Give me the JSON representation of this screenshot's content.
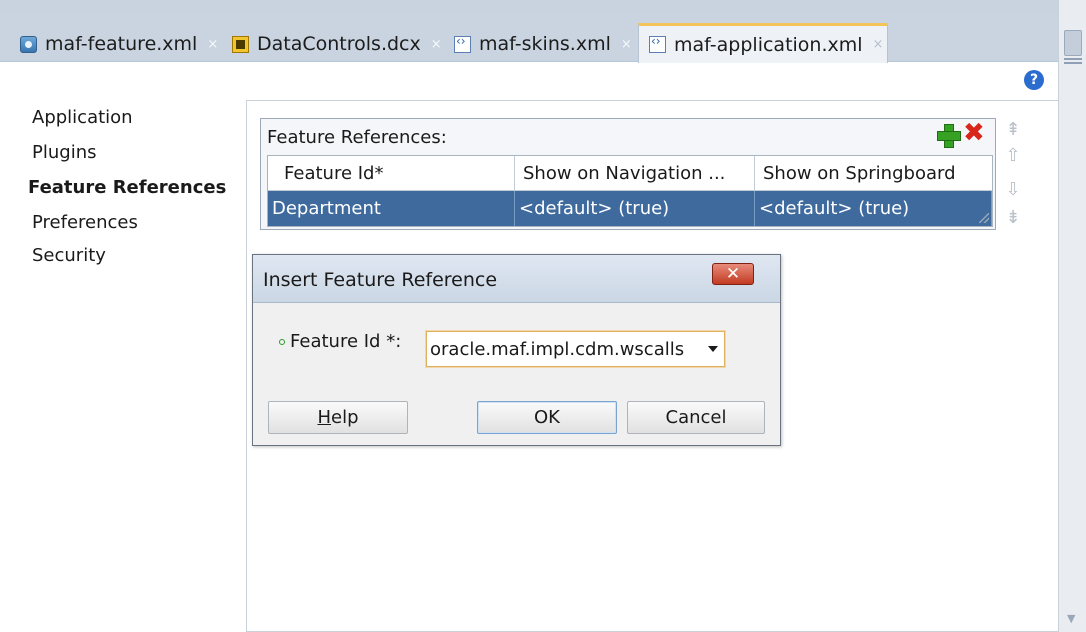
{
  "tabs": [
    {
      "label": "maf-feature.xml",
      "icon": "feature-file-icon",
      "active": false
    },
    {
      "label": "DataControls.dcx",
      "icon": "data-controls-file-icon",
      "active": false
    },
    {
      "label": "maf-skins.xml",
      "icon": "xml-file-icon",
      "active": false
    },
    {
      "label": "maf-application.xml",
      "icon": "xml-file-icon",
      "active": true
    }
  ],
  "tab_close_glyph": "×",
  "help_glyph": "?",
  "sidebar": {
    "items": [
      {
        "label": "Application",
        "selected": false
      },
      {
        "label": "Plugins",
        "selected": false
      },
      {
        "label": "Feature References",
        "selected": true
      },
      {
        "label": "Preferences",
        "selected": false
      },
      {
        "label": "Security",
        "selected": false
      }
    ]
  },
  "feature_refs": {
    "title": "Feature References:",
    "columns": [
      "Feature Id*",
      "Show on Navigation ...",
      "Show on Springboard"
    ],
    "rows": [
      {
        "feature_id": "Department",
        "show_nav": "<default> (true)",
        "show_springboard": "<default> (true)",
        "selected": true
      }
    ]
  },
  "dialog": {
    "title": "Insert Feature Reference",
    "close_glyph": "✕",
    "field_label": "Feature Id *:",
    "field_value": "oracle.maf.impl.cdm.wscalls",
    "buttons": {
      "help_prefix": "H",
      "help_rest": "elp",
      "ok": "OK",
      "cancel": "Cancel"
    }
  },
  "colors": {
    "selection": "#3e6a9e",
    "tabbar": "#c9d4e0",
    "close_red": "#c23b22",
    "add_green": "#35a224",
    "delete_red": "#d8261b"
  }
}
